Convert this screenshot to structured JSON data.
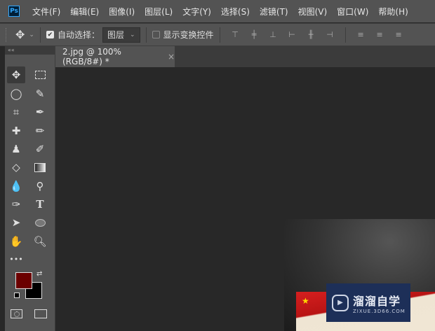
{
  "app": {
    "logo": "Ps"
  },
  "menu": [
    "文件(F)",
    "编辑(E)",
    "图像(I)",
    "图层(L)",
    "文字(Y)",
    "选择(S)",
    "滤镜(T)",
    "视图(V)",
    "窗口(W)",
    "帮助(H)"
  ],
  "options": {
    "auto_select_label": "自动选择：",
    "auto_select_checked": true,
    "auto_select_target": "图层",
    "show_transform_label": "显示变换控件",
    "show_transform_checked": false
  },
  "document_tab": {
    "title": "2.jpg @ 100%(RGB/8#) *",
    "close": "×"
  },
  "toolbar": {
    "collapse": "««",
    "more": "•••"
  },
  "colors": {
    "foreground": "#6b0000",
    "background": "#000000",
    "accent": "#31a8ff"
  },
  "watermark": {
    "title": "溜溜自学",
    "url": "ZIXUE.3D66.COM"
  }
}
